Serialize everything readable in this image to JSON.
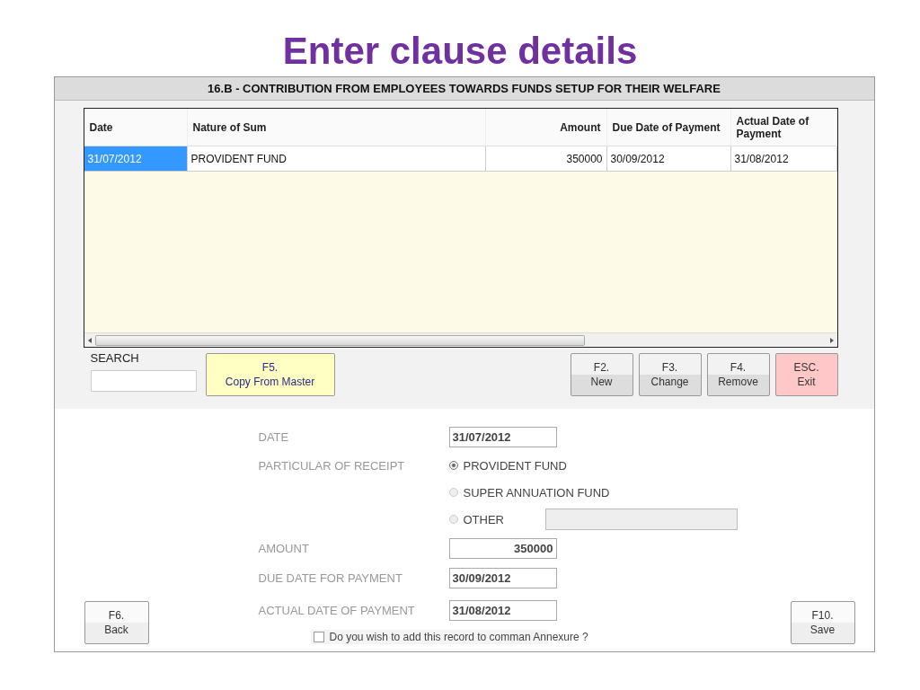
{
  "heading": "Enter clause details",
  "window": {
    "title": "16.B - CONTRIBUTION FROM EMPLOYEES TOWARDS FUNDS SETUP FOR THEIR WELFARE"
  },
  "table": {
    "columns": [
      {
        "label": "Date"
      },
      {
        "label": "Nature of Sum"
      },
      {
        "label": "Amount"
      },
      {
        "label": "Due Date of Payment"
      },
      {
        "label": "Actual Date of Payment"
      }
    ],
    "rows": [
      {
        "selected": true,
        "cells": [
          "31/07/2012",
          "PROVIDENT FUND",
          "350000",
          "30/09/2012",
          "31/08/2012"
        ]
      }
    ]
  },
  "search": {
    "label": "SEARCH"
  },
  "copy_button": {
    "key": "F5.",
    "label": "Copy From Master"
  },
  "toolbar": [
    {
      "key": "F2.",
      "label": "New",
      "kind": "normal"
    },
    {
      "key": "F3.",
      "label": "Change",
      "kind": "normal"
    },
    {
      "key": "F4.",
      "label": "Remove",
      "kind": "normal"
    },
    {
      "key": "ESC.",
      "label": "Exit",
      "kind": "danger"
    }
  ],
  "form": [
    {
      "kind": "field",
      "label": "DATE",
      "value": "31/07/2012"
    },
    {
      "kind": "radio",
      "label": "PARTICULAR OF RECEIPT",
      "text": "PROVIDENT FUND",
      "selected": true
    },
    {
      "kind": "radio",
      "text": "SUPER ANNUATION FUND",
      "selected": false
    },
    {
      "kind": "radio",
      "text": "OTHER",
      "selected": false,
      "other_field": true
    },
    {
      "kind": "number",
      "label": "AMOUNT",
      "value": "350000"
    },
    {
      "kind": "field",
      "label": "DUE DATE FOR PAYMENT",
      "value": "30/09/2012"
    },
    {
      "kind": "field",
      "label": "ACTUAL DATE OF PAYMENT",
      "value": "31/08/2012"
    }
  ],
  "annexure": {
    "label": "Do you wish to add this record to comman Annexure ?",
    "checked": false
  },
  "back_button": {
    "key": "F6.",
    "label": "Back"
  },
  "save_button": {
    "key": "F10.",
    "label": "Save"
  }
}
